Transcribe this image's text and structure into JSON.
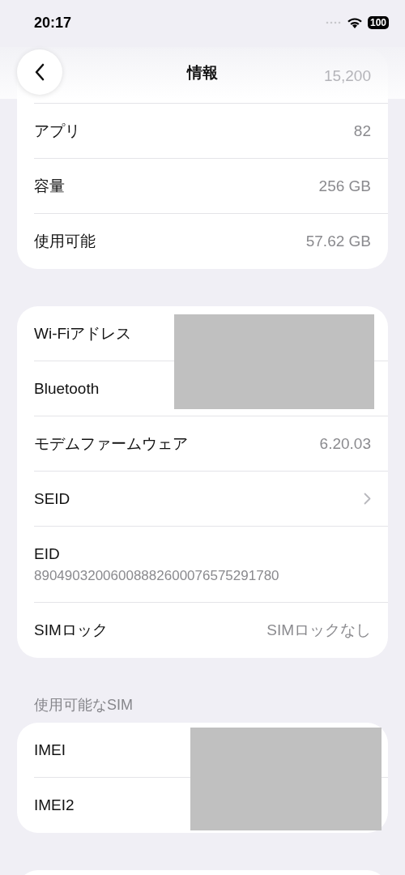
{
  "status_bar": {
    "time": "20:17",
    "battery": "100"
  },
  "nav": {
    "title": "情報"
  },
  "groups": [
    {
      "rows": [
        {
          "kind": "hidden",
          "label": "",
          "value": "15,200"
        },
        {
          "kind": "value",
          "label": "アプリ",
          "value": "82"
        },
        {
          "kind": "value",
          "label": "容量",
          "value": "256 GB"
        },
        {
          "kind": "value",
          "label": "使用可能",
          "value": "57.62 GB"
        }
      ]
    },
    {
      "rows": [
        {
          "kind": "redacted",
          "label": "Wi-Fiアドレス"
        },
        {
          "kind": "redacted",
          "label": "Bluetooth"
        },
        {
          "kind": "value",
          "label": "モデムファームウェア",
          "value": "6.20.03"
        },
        {
          "kind": "link",
          "label": "SEID"
        },
        {
          "kind": "stacked",
          "label": "EID",
          "value": "89049032006008882600076575291780"
        },
        {
          "kind": "value",
          "label": "SIMロック",
          "value": "SIMロックなし"
        }
      ]
    },
    {
      "header": "使用可能なSIM",
      "rows": [
        {
          "kind": "redacted",
          "label": "IMEI"
        },
        {
          "kind": "redacted",
          "label": "IMEI2"
        }
      ]
    }
  ]
}
